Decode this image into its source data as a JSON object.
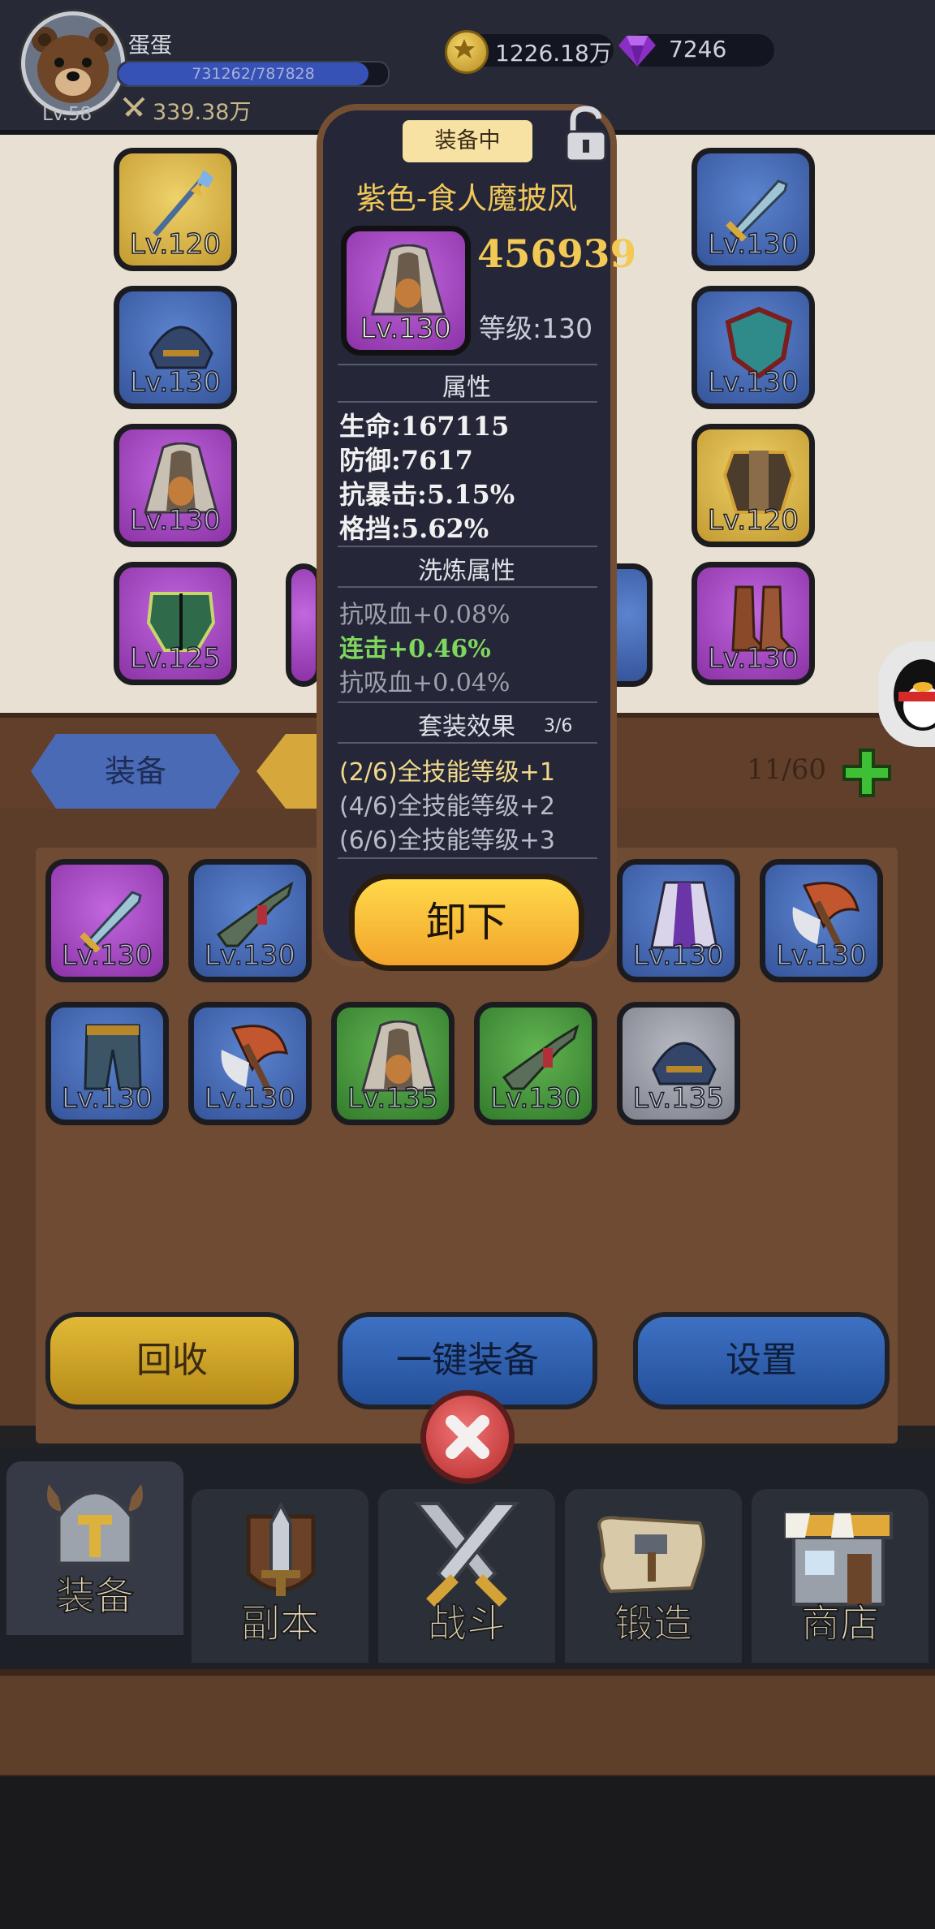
{
  "player": {
    "name": "蛋蛋",
    "level_label": "Lv.58",
    "exp_text": "731262/787828",
    "exp_fraction": 0.928,
    "power": "339.38万"
  },
  "currency": {
    "gold": "1226.18万",
    "gems": "7246"
  },
  "equipped_slots": [
    {
      "level": "Lv.120",
      "quality": "gold",
      "item": "spear"
    },
    {
      "level": "Lv.130",
      "quality": "blue",
      "item": "sword"
    },
    {
      "level": "Lv.130",
      "quality": "blue",
      "item": "helmet"
    },
    {
      "level": "Lv.130",
      "quality": "blue",
      "item": "shield"
    },
    {
      "level": "Lv.130",
      "quality": "purple",
      "item": "cloak"
    },
    {
      "level": "Lv.120",
      "quality": "gold",
      "item": "armor"
    },
    {
      "level": "Lv.125",
      "quality": "purple",
      "item": "chestplate"
    },
    {
      "level": "Lv.130",
      "quality": "purple",
      "item": "boots"
    }
  ],
  "tabs": {
    "equip_label": "装备",
    "bag_count": "11/60"
  },
  "inventory": [
    {
      "level": "Lv.130",
      "quality": "purple",
      "item": "sword"
    },
    {
      "level": "Lv.130",
      "quality": "blue",
      "item": "gun"
    },
    {
      "level": "Lv.130",
      "quality": "blue",
      "item": "robe"
    },
    {
      "level": "Lv.130",
      "quality": "blue",
      "item": "axe"
    },
    {
      "level": "Lv.130",
      "quality": "blue",
      "item": "pants"
    },
    {
      "level": "Lv.130",
      "quality": "blue",
      "item": "axe"
    },
    {
      "level": "Lv.135",
      "quality": "green",
      "item": "cloak"
    },
    {
      "level": "Lv.130",
      "quality": "green",
      "item": "gun"
    },
    {
      "level": "Lv.135",
      "quality": "gray",
      "item": "helmet"
    }
  ],
  "actions": {
    "recycle": "回收",
    "one_click_equip": "一键装备",
    "settings": "设置"
  },
  "nav": [
    {
      "label": "装备",
      "icon": "helmet-icon"
    },
    {
      "label": "副本",
      "icon": "dungeon-sword-icon"
    },
    {
      "label": "战斗",
      "icon": "crossed-swords-icon"
    },
    {
      "label": "锻造",
      "icon": "forge-scroll-icon"
    },
    {
      "label": "商店",
      "icon": "shop-icon"
    }
  ],
  "popup": {
    "status_badge": "装备中",
    "title": "紫色-食人魔披风",
    "item_level_badge": "Lv.130",
    "power": "456939",
    "level_text": "等级:130",
    "attributes_header": "属性",
    "attributes": [
      "生命:167115",
      "防御:7617",
      "抗暴击:5.15%",
      "格挡:5.62%"
    ],
    "refine_header": "洗炼属性",
    "refine": [
      {
        "text": "抗吸血+0.08%",
        "highlight": false
      },
      {
        "text": "连击+0.46%",
        "highlight": true
      },
      {
        "text": "抗吸血+0.04%",
        "highlight": false
      }
    ],
    "set_header": "套装效果",
    "set_progress": "3/6",
    "set_effects": [
      {
        "text": "(2/6)全技能等级+1",
        "active": true
      },
      {
        "text": "(4/6)全技能等级+2",
        "active": false
      },
      {
        "text": "(6/6)全技能等级+3",
        "active": false
      }
    ],
    "unequip_button": "卸下"
  },
  "colors": {
    "purple": "#9a3fb8",
    "blue": "#3f5fa8",
    "gold": "#d4ad3c",
    "green": "#3f8c36",
    "gray": "#8f929b",
    "popup_title": "#f0c75a",
    "refine_highlight": "#7fd65e"
  }
}
